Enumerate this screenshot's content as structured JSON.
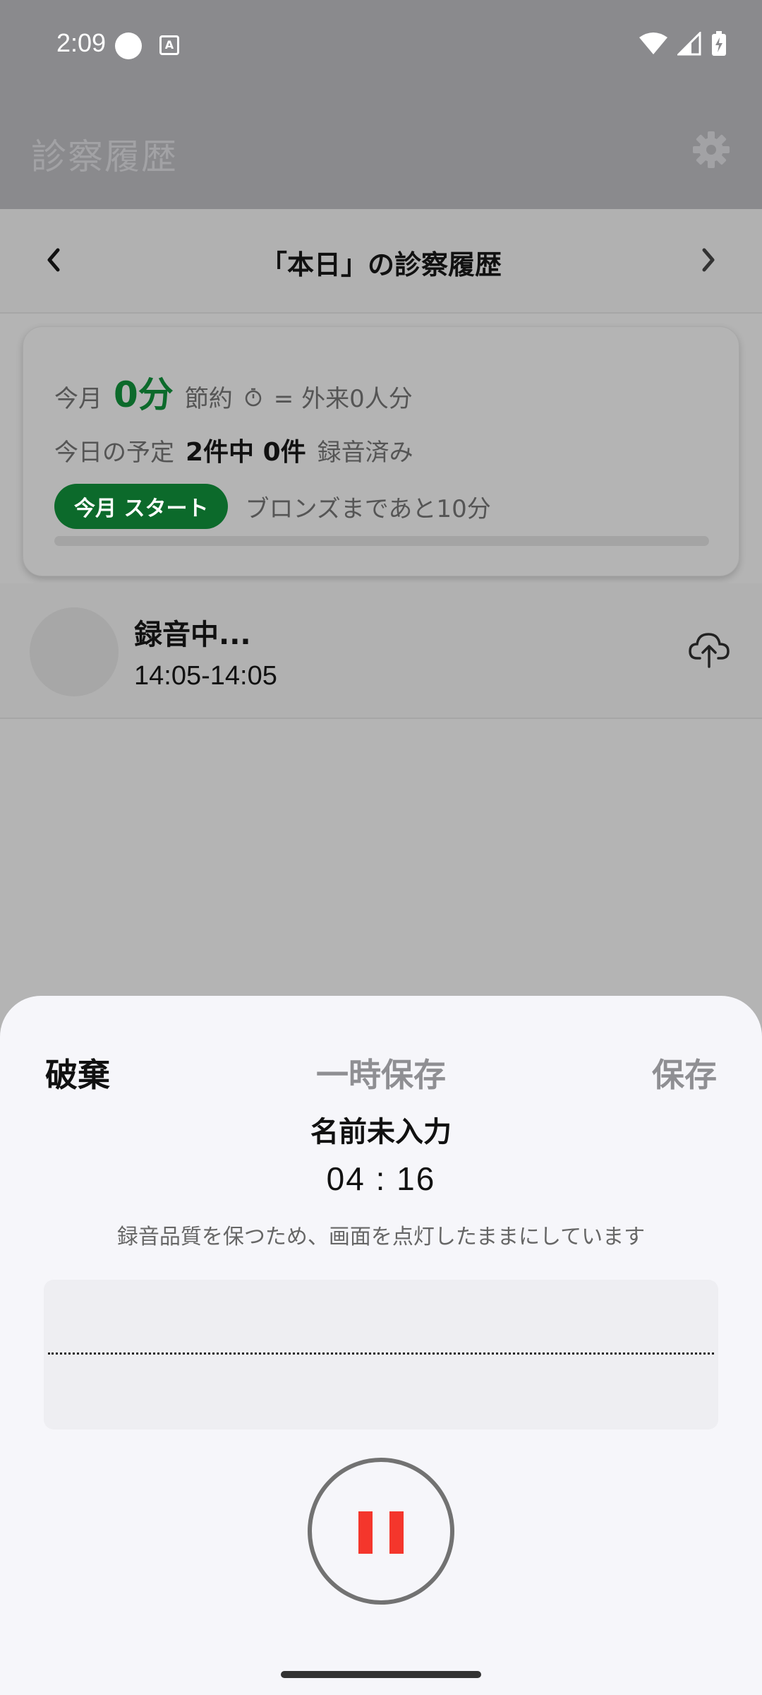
{
  "status": {
    "time": "2:09"
  },
  "header": {
    "title": "診察履歴"
  },
  "date_nav": {
    "title": "「本日」の診察履歴"
  },
  "summary": {
    "month_label": "今月",
    "month_minutes": "0分",
    "saved_label": "節約",
    "saved_equiv": "= 外来0人分",
    "today_label": "今日の予定",
    "today_count": "2件中 0件",
    "recorded_label": "録音済み",
    "badge_label": "今月 スタート",
    "rank_text": "ブロンズまであと10分",
    "progress_fraction": 0.0
  },
  "record_item": {
    "title": "録音中...",
    "time": "14:05-14:05"
  },
  "sheet": {
    "discard_label": "破棄",
    "temp_save_label": "一時保存",
    "save_label": "保存",
    "name": "名前未入力",
    "timer": "04 : 16",
    "note": "録音品質を保つため、画面を点灯したままにしています"
  },
  "colors": {
    "accent_green": "#0c6a2b",
    "pause_red": "#f4362c"
  }
}
